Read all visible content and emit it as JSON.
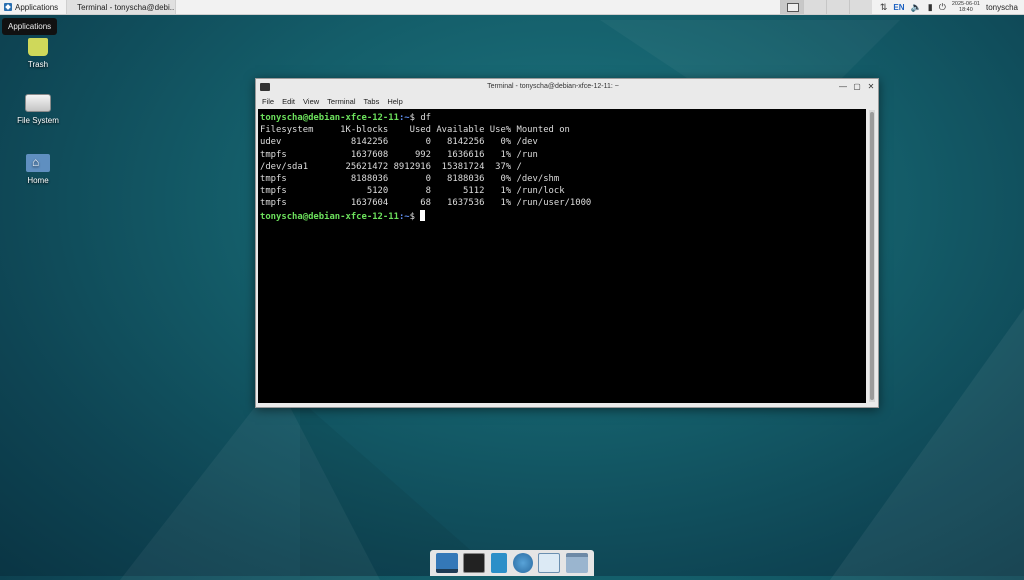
{
  "top_panel": {
    "applications_label": "Applications",
    "task_title": "Terminal - tonyscha@debi...",
    "keyboard_layout": "EN",
    "date": "2025-06-01",
    "time": "18:40",
    "user": "tonyscha"
  },
  "tooltip": {
    "text": "Applications"
  },
  "desktop_icons": [
    {
      "label": "Trash"
    },
    {
      "label": "File System"
    },
    {
      "label": "Home"
    }
  ],
  "terminal": {
    "window_title": "Terminal - tonyscha@debian-xfce-12-11: ~",
    "menu": [
      "File",
      "Edit",
      "View",
      "Terminal",
      "Tabs",
      "Help"
    ],
    "prompt_user": "tonyscha@debian-xfce-12-11",
    "prompt_path": ":~",
    "command": "df",
    "output_lines": [
      "Filesystem     1K-blocks    Used Available Use% Mounted on",
      "udev             8142256       0   8142256   0% /dev",
      "tmpfs            1637608     992   1636616   1% /run",
      "/dev/sda1       25621472 8912916  15381724  37% /",
      "tmpfs            8188036       0   8188036   0% /dev/shm",
      "tmpfs               5120       8      5112   1% /run/lock",
      "tmpfs            1637604      68   1637536   1% /run/user/1000"
    ]
  },
  "icons": {
    "applications": "xfce-menu-icon",
    "task": "terminal-icon",
    "tray": [
      "network-icon",
      "volume-icon",
      "battery-icon",
      "power-icon"
    ],
    "dock": [
      "show-desktop-icon",
      "terminal-icon",
      "file-manager-icon",
      "web-browser-icon",
      "app-finder-icon",
      "folder-icon"
    ]
  },
  "colors": {
    "prompt_user": "#6ce05c",
    "prompt_path": "#5f8ff0",
    "terminal_bg": "#000000"
  }
}
